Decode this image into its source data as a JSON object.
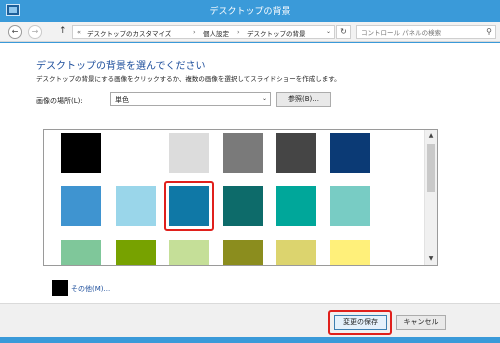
{
  "window": {
    "title": "デスクトップの背景"
  },
  "address": {
    "back_glyph": "←",
    "forward_glyph": "→",
    "up_glyph": "↑",
    "prefix": "«",
    "crumbs": [
      "デスクトップのカスタマイズ",
      "個人設定",
      "デスクトップの背景"
    ],
    "separator": "›",
    "dropdown_glyph": "⌄",
    "refresh_glyph": "↻",
    "search_placeholder": "コントロール パネルの検索",
    "search_glyph": "⚲"
  },
  "main": {
    "heading": "デスクトップの背景を選んでください",
    "description": "デスクトップの背景にする画像をクリックするか、複数の画像を選択してスライドショーを作成します。",
    "location_label": "画像の場所(L):",
    "location_value": "単色",
    "location_dropdown_glyph": "⌄",
    "browse_label": "参照(B)...",
    "swatch_colors": [
      [
        "#000000",
        "",
        "#dcdcdc",
        "#7a7a7a",
        "#454545",
        "#0b3a75"
      ],
      [
        "#3f94d0",
        "#9ad6ea",
        "#0f78a6",
        "#0d6b6a",
        "#00a79a",
        "#78ccc4"
      ],
      [
        "#7fc79a",
        "#77a200",
        "#c5df98",
        "#8b8d1e",
        "#dcd46e",
        "#fff07a"
      ]
    ],
    "selected_color": "#0f78a6",
    "scroll_up_glyph": "▲",
    "scroll_down_glyph": "▼",
    "other_color_swatch": "#000000",
    "other_color_label": "その他(M)..."
  },
  "footer": {
    "save_label": "変更の保存",
    "cancel_label": "キャンセル"
  },
  "accent_colors": {
    "highlight": "#e0201c",
    "titlebar": "#3a9ad9",
    "heading": "#1e4f9c"
  }
}
